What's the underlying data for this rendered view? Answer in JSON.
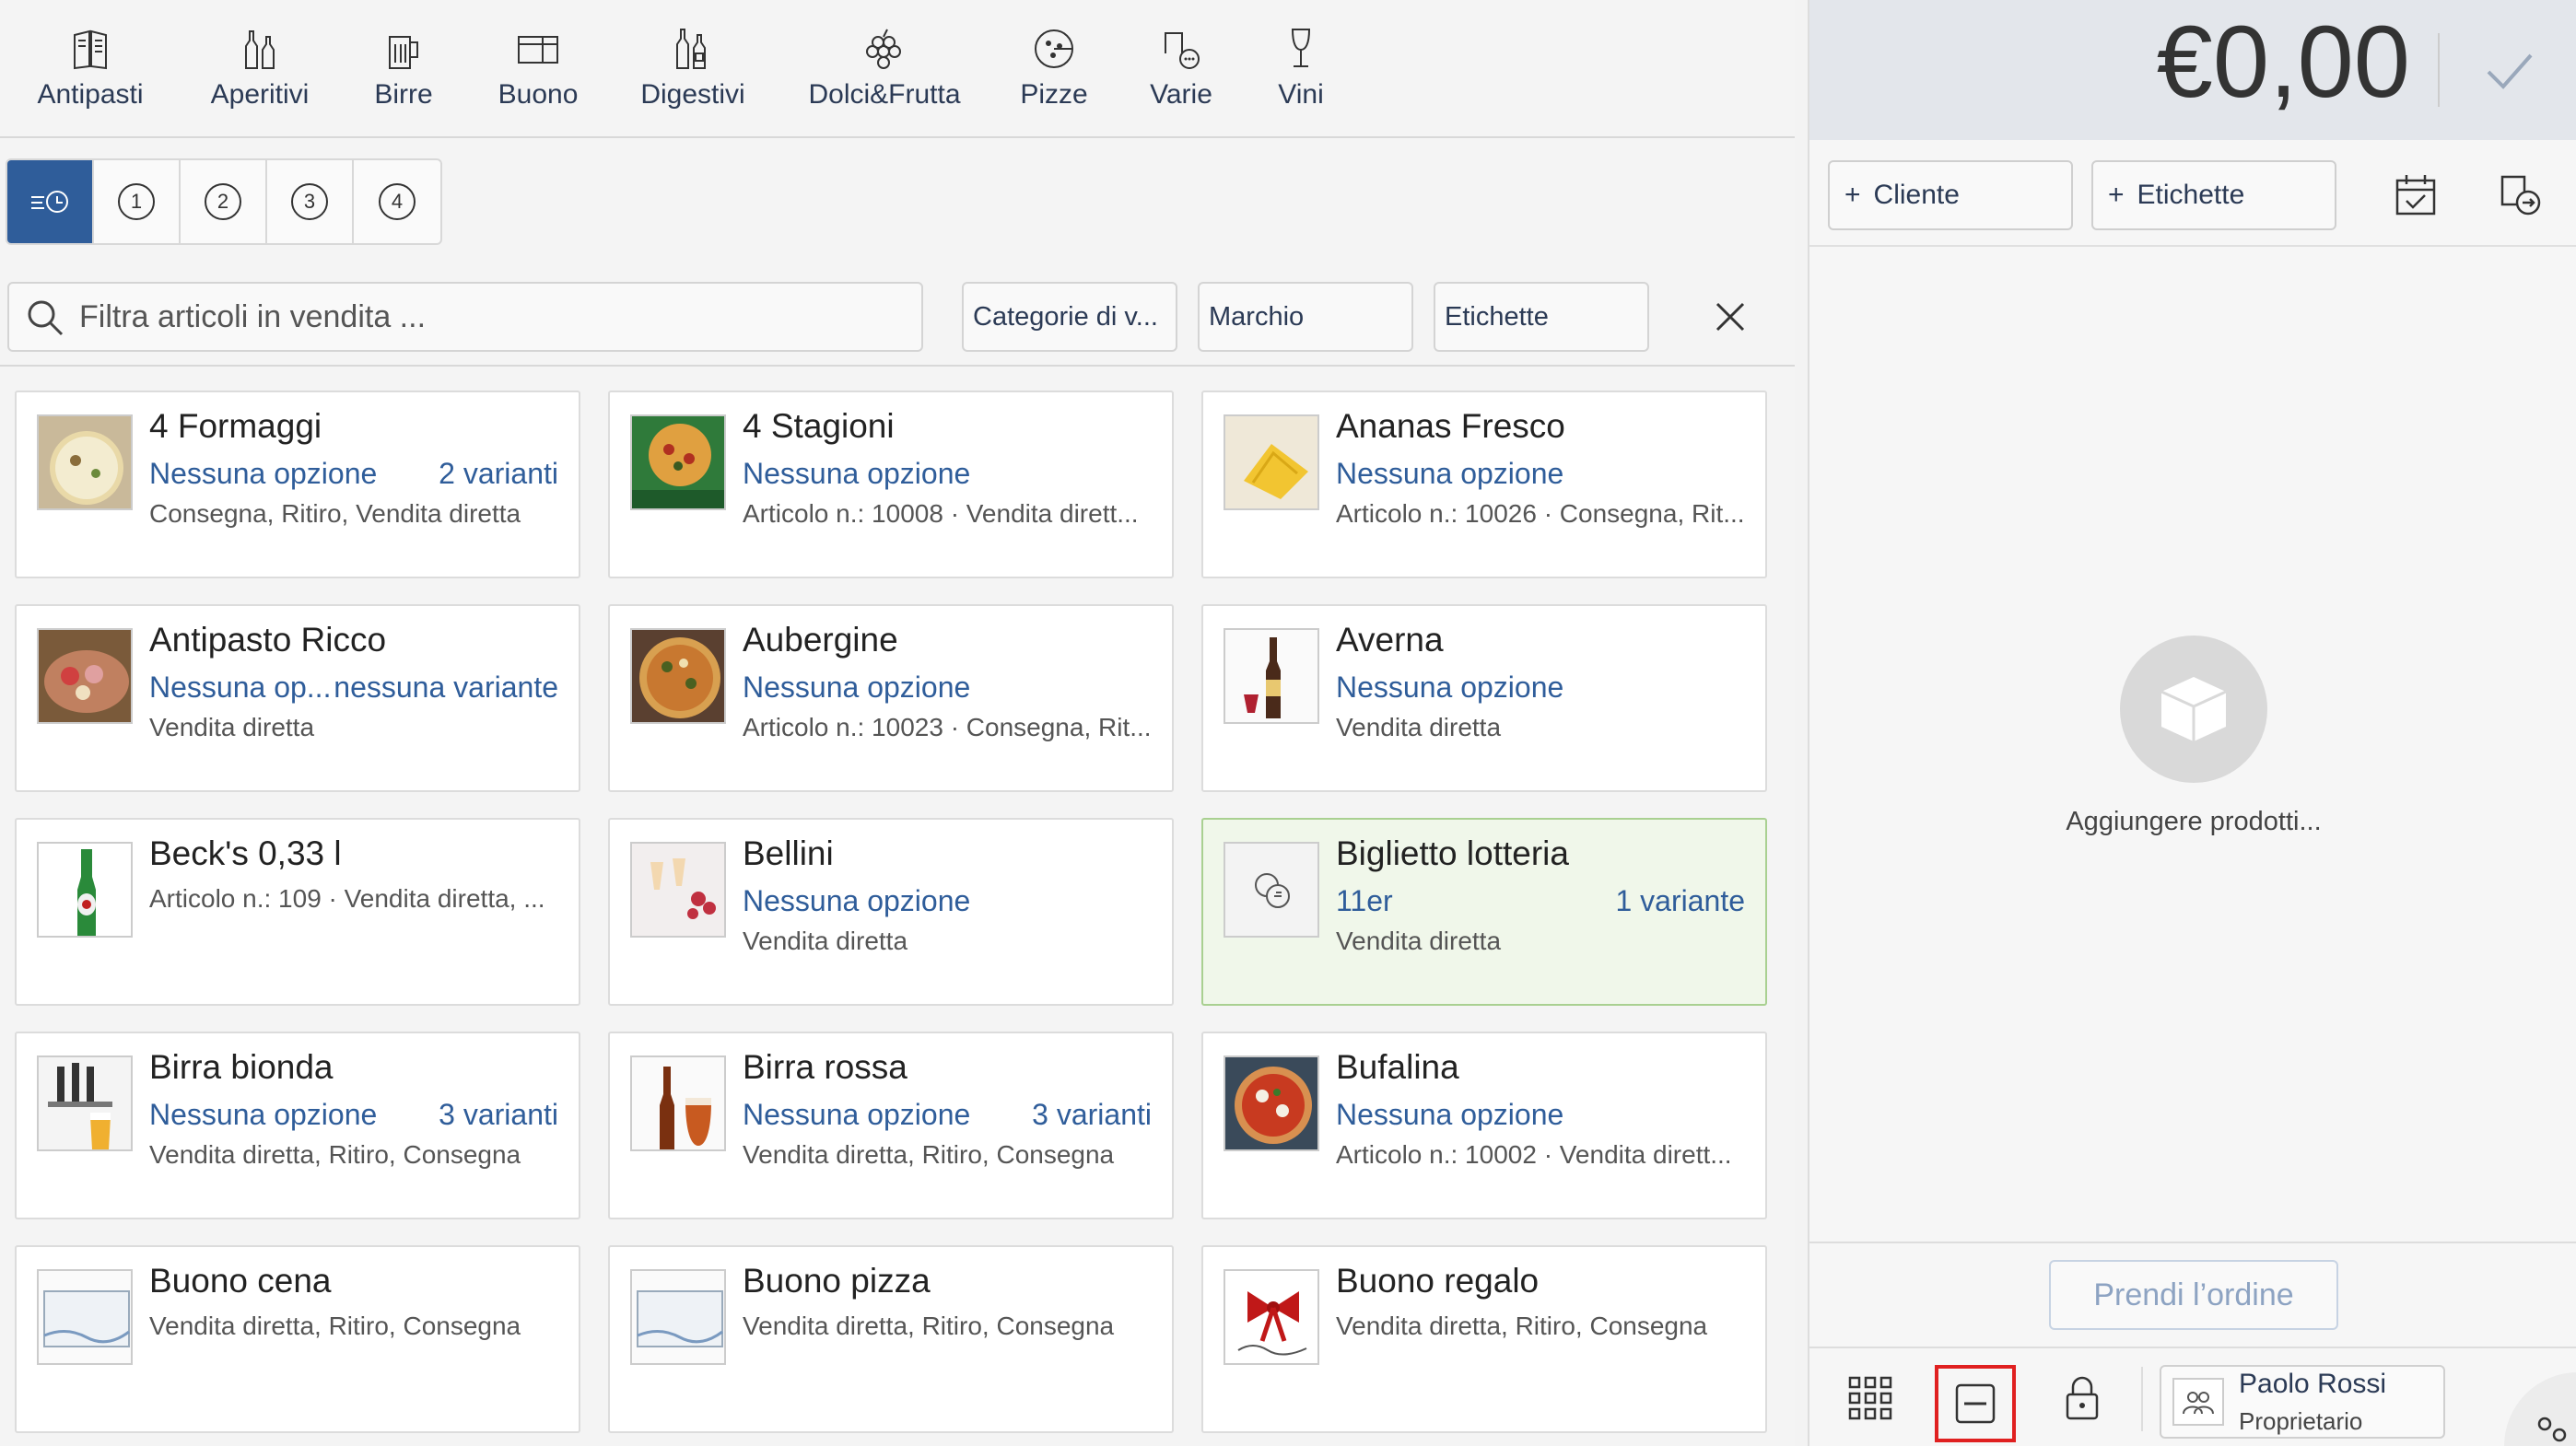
{
  "categories": [
    {
      "label": "Antipasti",
      "icon": "menu-book-icon"
    },
    {
      "label": "Aperitivi",
      "icon": "bottles-icon"
    },
    {
      "label": "Birre",
      "icon": "beer-mug-icon"
    },
    {
      "label": "Buono",
      "icon": "voucher-icon"
    },
    {
      "label": "Digestivi",
      "icon": "liquor-bottles-icon"
    },
    {
      "label": "Dolci&Frutta",
      "icon": "grapes-icon"
    },
    {
      "label": "Pizze",
      "icon": "pizza-icon"
    },
    {
      "label": "Varie",
      "icon": "misc-icon"
    },
    {
      "label": "Vini",
      "icon": "wine-glass-icon"
    }
  ],
  "view_tabs": {
    "recent_icon": "recent-list-icon",
    "numbers": [
      "1",
      "2",
      "3",
      "4"
    ]
  },
  "search": {
    "placeholder": "Filtra articoli in vendita ..."
  },
  "filters": {
    "category": "Categorie di v...",
    "brand": "Marchio",
    "tags": "Etichette"
  },
  "products": [
    {
      "title": "4 Formaggi",
      "option": "Nessuna opzione",
      "variants": "2 varianti",
      "details": "Consegna, Ritiro, Vendita diretta",
      "thumb": "pizza",
      "highlight": false
    },
    {
      "title": "4 Stagioni",
      "option": "Nessuna opzione",
      "variants": "",
      "details": "Articolo n.: 10008 · Vendita dirett...",
      "thumb": "pizza-box",
      "highlight": false
    },
    {
      "title": "Ananas Fresco",
      "option": "Nessuna opzione",
      "variants": "",
      "details": "Articolo n.: 10026 · Consegna, Rit...",
      "thumb": "pineapple",
      "highlight": false
    },
    {
      "title": "Antipasto Ricco",
      "option": "Nessuna op...",
      "variants": "nessuna variante",
      "details": "Vendita diretta",
      "thumb": "antipasto",
      "highlight": false
    },
    {
      "title": "Aubergine",
      "option": "Nessuna opzione",
      "variants": "",
      "details": "Articolo n.: 10023 · Consegna, Rit...",
      "thumb": "pizza",
      "highlight": false
    },
    {
      "title": "Averna",
      "option": "Nessuna opzione",
      "variants": "",
      "details": "Vendita diretta",
      "thumb": "liquor",
      "highlight": false
    },
    {
      "title": "Beck's 0,33 l",
      "option": "",
      "variants": "",
      "details": "Articolo n.: 109 · Vendita diretta, ...",
      "thumb": "beer-bottle",
      "highlight": false
    },
    {
      "title": "Bellini",
      "option": "Nessuna opzione",
      "variants": "",
      "details": "Vendita diretta",
      "thumb": "glasses",
      "highlight": false
    },
    {
      "title": "Biglietto lotteria",
      "option": "11er",
      "variants": "1 variante",
      "details": "Vendita diretta",
      "thumb": "placeholder",
      "highlight": true
    },
    {
      "title": "Birra bionda",
      "option": "Nessuna opzione",
      "variants": "3 varianti",
      "details": "Vendita diretta, Ritiro, Consegna",
      "thumb": "tap",
      "highlight": false
    },
    {
      "title": "Birra rossa",
      "option": "Nessuna opzione",
      "variants": "3 varianti",
      "details": "Vendita diretta, Ritiro, Consegna",
      "thumb": "red-beer",
      "highlight": false
    },
    {
      "title": "Bufalina",
      "option": "Nessuna opzione",
      "variants": "",
      "details": "Articolo n.: 10002 · Vendita dirett...",
      "thumb": "pizza",
      "highlight": false
    },
    {
      "title": "Buono cena",
      "option": "",
      "variants": "",
      "details": "Vendita diretta, Ritiro, Consegna",
      "thumb": "voucher",
      "highlight": false
    },
    {
      "title": "Buono pizza",
      "option": "",
      "variants": "",
      "details": "Vendita diretta, Ritiro, Consegna",
      "thumb": "voucher",
      "highlight": false
    },
    {
      "title": "Buono regalo",
      "option": "",
      "variants": "",
      "details": "Vendita diretta, Ritiro, Consegna",
      "thumb": "gift",
      "highlight": false
    }
  ],
  "order": {
    "total": "€0,00",
    "customer_label": "Cliente",
    "tags_label": "Etichette",
    "empty_text": "Aggiungere prodotti...",
    "take_order": "Prendi l’ordine"
  },
  "user": {
    "name": "Paolo Rossi",
    "role": "Proprietario"
  },
  "colors": {
    "accent": "#2f5d9a",
    "highlight_bg": "#f0f7ea",
    "focus": "#e02020"
  }
}
